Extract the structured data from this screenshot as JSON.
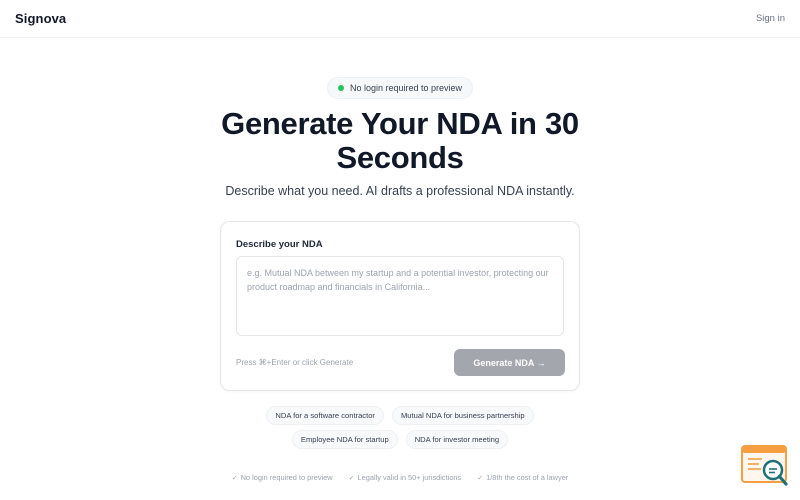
{
  "header": {
    "brand": "Signova",
    "signin_label": "Sign in"
  },
  "hero": {
    "badge_text": "No login required to preview",
    "title_line1": "Generate Your NDA in 30",
    "title_line2": "Seconds",
    "subtitle": "Describe what you need. AI drafts a professional NDA instantly."
  },
  "form": {
    "label": "Describe your NDA",
    "placeholder": "e.g. Mutual NDA between my startup and a potential investor, protecting our product roadmap and financials in California...",
    "value": "",
    "hint": "Press ⌘+Enter or click Generate",
    "generate_label": "Generate NDA →"
  },
  "chips": {
    "row1": [
      "NDA for a software contractor",
      "Mutual NDA for business partnership"
    ],
    "row2": [
      "Employee NDA for startup",
      "NDA for investor meeting"
    ]
  },
  "features": [
    "No login required to preview",
    "Legally valid in 50+ jurisdictions",
    "1/8th the cost of a lawyer"
  ],
  "colors": {
    "badge_dot": "#22c55e",
    "button_disabled": "#a3a7ad",
    "widget_accent": "#f59e42",
    "widget_teal": "#1f6f78"
  },
  "icons": {
    "check": "check-icon",
    "widget": "search-document-icon"
  }
}
